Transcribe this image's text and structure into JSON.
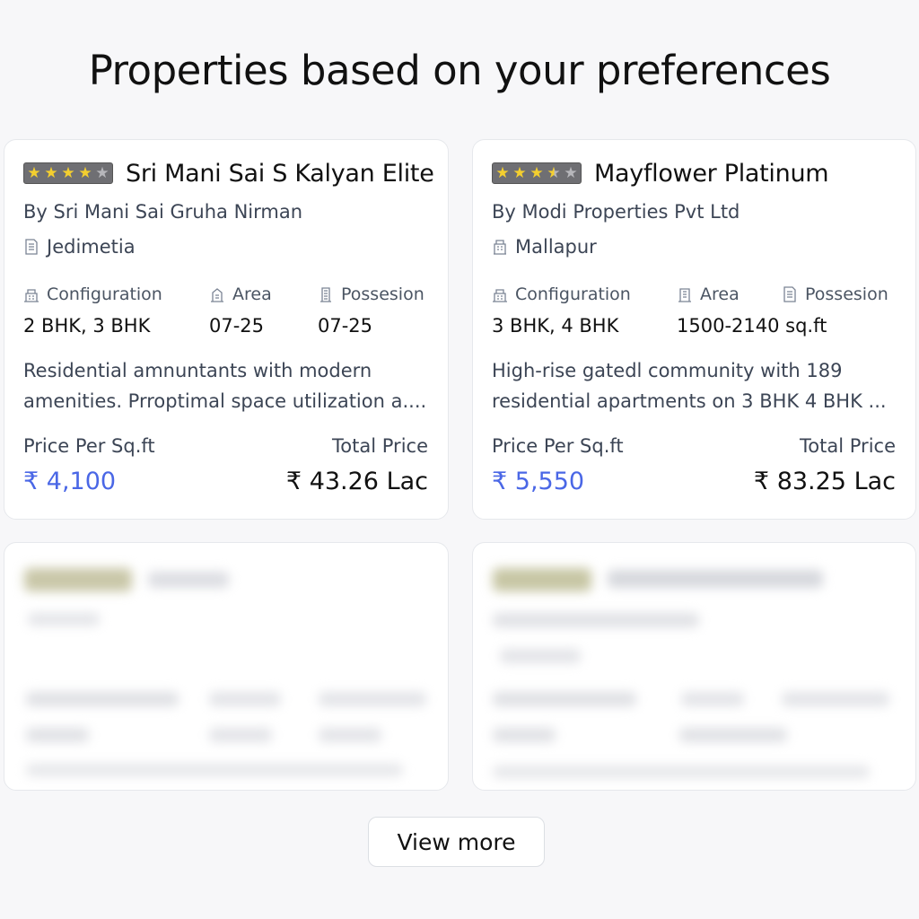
{
  "page": {
    "title": "Properties based on your preferences",
    "view_more_label": "View more"
  },
  "currency_symbol": "₹",
  "colors": {
    "accent": "#4a67e6",
    "star_filled": "#f4cf2f",
    "star_empty": "#b7b7bb",
    "background": "#f7f7f9"
  },
  "spec_labels": {
    "configuration": "Configuration",
    "area": "Area",
    "possession": "Possesion"
  },
  "price_labels": {
    "per_sqft": "Price Per Sq.ft",
    "total": "Total Price"
  },
  "properties": [
    {
      "name": "Sri Mani Sai S Kalyan Elite",
      "rating": 4,
      "builder": "By Sri Mani Sai Gruha Nirman",
      "location": "Jedimetia",
      "configuration": "2 BHK, 3 BHK",
      "area": "07-25",
      "possession": "07-25",
      "description_line1": "Residential amnuntants with modern",
      "description_line2": "amenities. Prroptimal space utilization a....",
      "price_per_sqft": "4,100",
      "total_price": "43.26 Lac"
    },
    {
      "name": "Mayflower Platinum",
      "rating": 3.5,
      "builder": "By Modi Properties Pvt Ltd",
      "location": "Mallapur",
      "configuration": "3 BHK, 4  BHK",
      "area": "1500-2140 sq.ft",
      "possession": "",
      "description_line1": "High-rise gatedl community with 189",
      "description_line2": "residential apartments on 3 BHK 4 BHK ...",
      "price_per_sqft": "5,550",
      "total_price": "83.25 Lac"
    }
  ]
}
